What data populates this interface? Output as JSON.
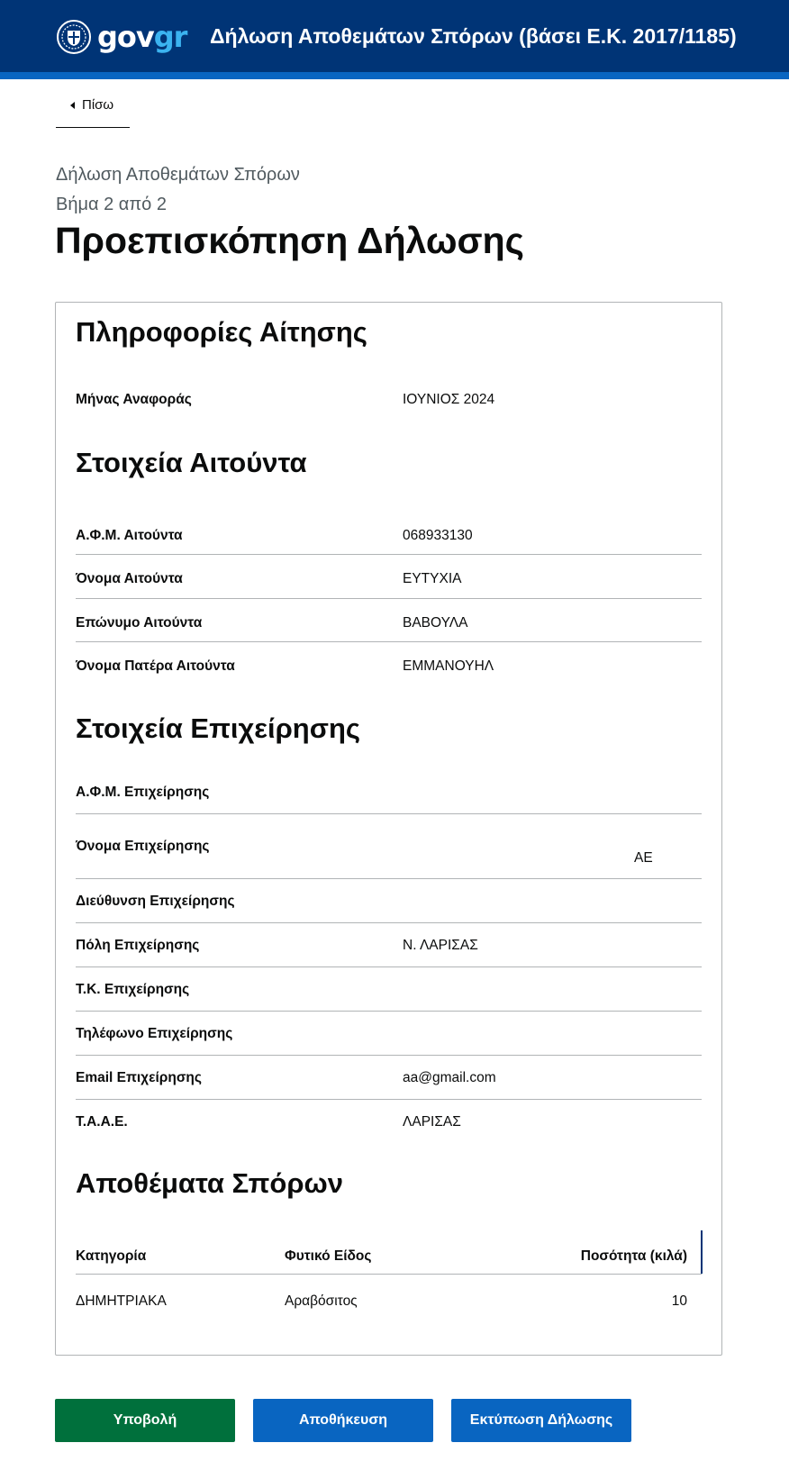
{
  "header": {
    "logo_gov": "gov",
    "logo_gr": "gr",
    "title": "Δήλωση Αποθεμάτων Σπόρων (βάσει Ε.Κ. 2017/1185)",
    "emblem_icon": "greek-emblem-icon"
  },
  "nav": {
    "back_label": "Πίσω",
    "back_icon": "caret-left-icon"
  },
  "page": {
    "caption": "Δήλωση Αποθεμάτων Σπόρων",
    "step": "Βήμα 2 από 2",
    "title": "Προεπισκόπηση Δήλωσης"
  },
  "application_info": {
    "title": "Πληροφορίες Αίτησης",
    "rows": [
      {
        "label": "Μήνας Αναφοράς",
        "value": "ΙΟΥΝΙΟΣ 2024"
      }
    ]
  },
  "applicant": {
    "title": "Στοιχεία Αιτούντα",
    "rows": [
      {
        "label": "Α.Φ.Μ. Αιτούντα",
        "value": "068933130"
      },
      {
        "label": "Όνομα Αιτούντα",
        "value": "ΕΥΤΥΧΙΑ"
      },
      {
        "label": "Επώνυμο Αιτούντα",
        "value": "ΒΑΒΟΥΛΑ"
      },
      {
        "label": "Όνομα Πατέρα Αιτούντα",
        "value": "ΕΜΜΑΝΟΥΗΛ"
      }
    ]
  },
  "business": {
    "title": "Στοιχεία Επιχείρησης",
    "rows": [
      {
        "label": "Α.Φ.Μ. Επιχείρησης",
        "value": ""
      },
      {
        "label": "Όνομα Επιχείρησης",
        "value": "ΑΕ"
      },
      {
        "label": "Διεύθυνση Επιχείρησης",
        "value": ""
      },
      {
        "label": "Πόλη Επιχείρησης",
        "value": "Ν. ΛΑΡΙΣΑΣ"
      },
      {
        "label": "Τ.Κ. Επιχείρησης",
        "value": ""
      },
      {
        "label": "Τηλέφωνο Επιχείρησης",
        "value": ""
      },
      {
        "label": "Email Επιχείρησης",
        "value": "aa@gmail.com"
      },
      {
        "label": "Τ.Α.Α.Ε.",
        "value": "ΛΑΡΙΣΑΣ"
      }
    ]
  },
  "stocks": {
    "title": "Αποθέματα Σπόρων",
    "columns": [
      "Κατηγορία",
      "Φυτικό Είδος",
      "Ποσότητα (κιλά)"
    ],
    "rows": [
      [
        "ΔΗΜΗΤΡΙΑΚΑ",
        "Αραβόσιτος",
        "10"
      ]
    ]
  },
  "actions": {
    "submit_label": "Υποβολή",
    "save_label": "Αποθήκευση",
    "print_label": "Εκτύπωση Δήλωσης"
  },
  "colors": {
    "header_bg": "#003476",
    "header_stripe": "#0965c1",
    "submit_green": "#00703c",
    "action_blue": "#0965c1"
  }
}
